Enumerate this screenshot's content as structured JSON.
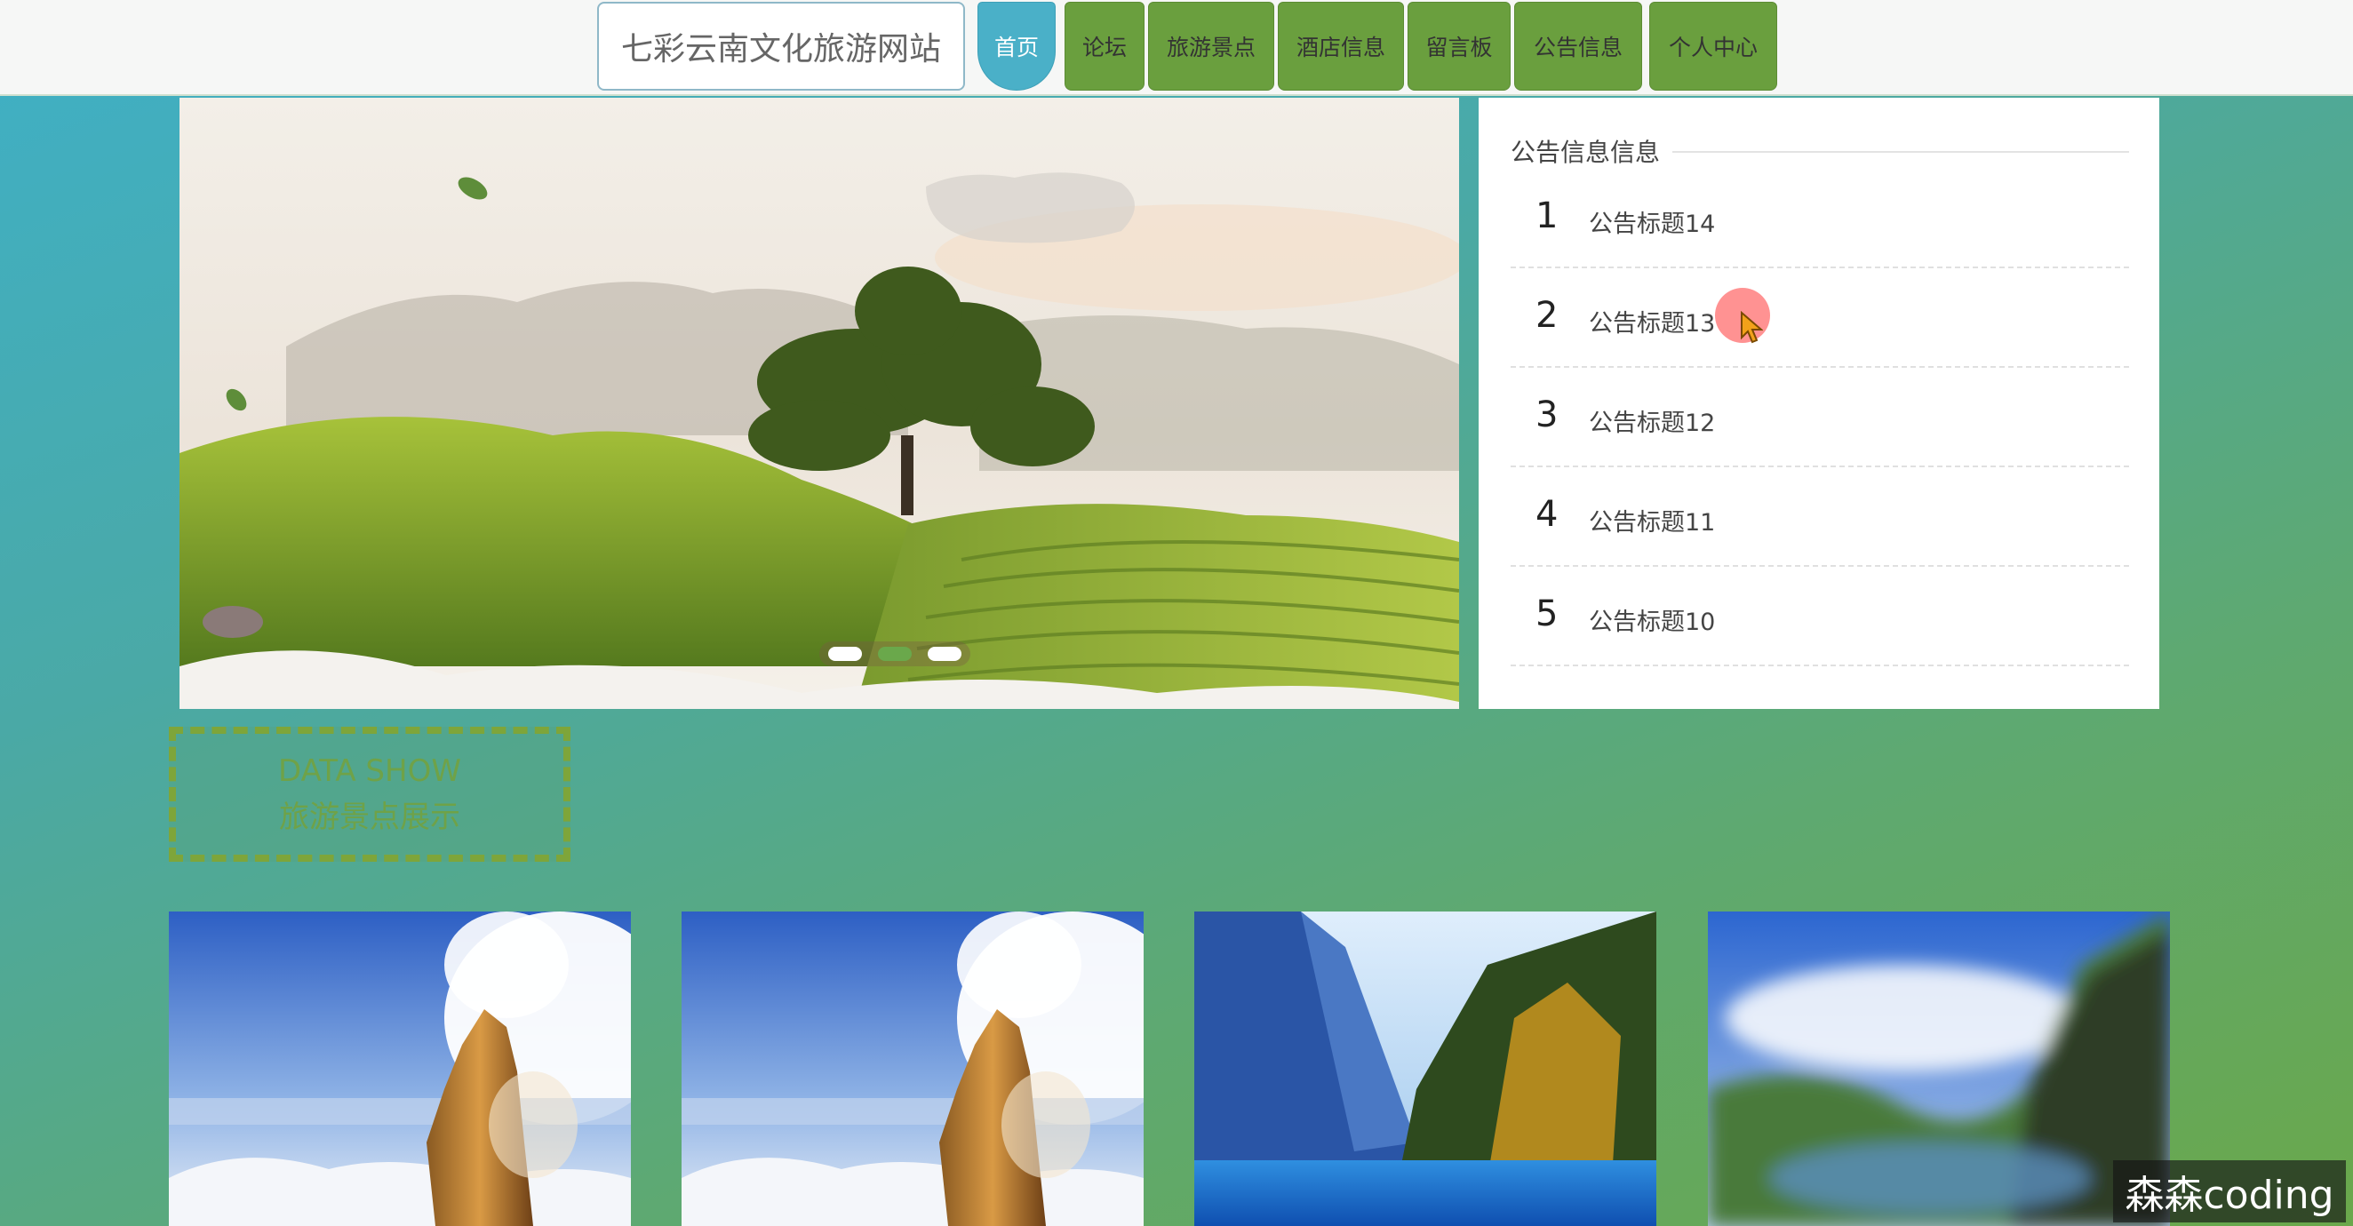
{
  "site_title": "七彩云南文化旅游网站",
  "nav": [
    {
      "label": "首页",
      "active": true
    },
    {
      "label": "论坛"
    },
    {
      "label": "旅游景点"
    },
    {
      "label": "酒店信息"
    },
    {
      "label": "留言板"
    },
    {
      "label": "公告信息"
    },
    {
      "label": "个人中心"
    }
  ],
  "carousel": {
    "slide_count": 3,
    "active_index": 1
  },
  "notice": {
    "heading": "公告信息信息",
    "items": [
      {
        "num": "1",
        "title": "公告标题14"
      },
      {
        "num": "2",
        "title": "公告标题13"
      },
      {
        "num": "3",
        "title": "公告标题12"
      },
      {
        "num": "4",
        "title": "公告标题11"
      },
      {
        "num": "5",
        "title": "公告标题10"
      }
    ]
  },
  "section": {
    "title_en": "DATA SHOW",
    "title_cn": "旅游景点展示"
  },
  "cards": [
    {
      "image": "mountain-peak-clouds"
    },
    {
      "image": "mountain-peak-clouds"
    },
    {
      "image": "lake-valley-forest"
    },
    {
      "image": "blurred-lake-landscape"
    }
  ],
  "watermark": "森森coding",
  "colors": {
    "accent_green": "#6a9f3e",
    "active_blue": "#4ab0c8",
    "section_border": "#7ea53a"
  }
}
